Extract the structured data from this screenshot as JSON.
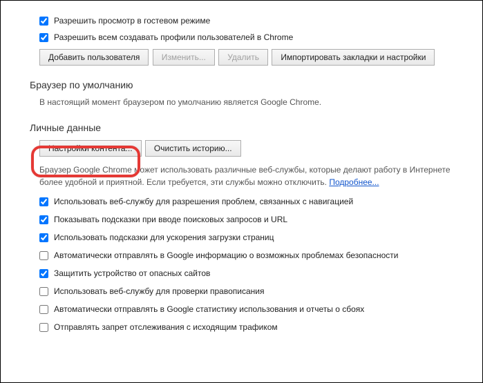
{
  "users_section": {
    "allow_guest": {
      "label": "Разрешить просмотр в гостевом режиме",
      "checked": true
    },
    "allow_create_profiles": {
      "label": "Разрешить всем создавать профили пользователей в Chrome",
      "checked": true
    },
    "btn_add": "Добавить пользователя",
    "btn_edit": "Изменить...",
    "btn_delete": "Удалить",
    "btn_import": "Импортировать закладки и настройки"
  },
  "default_browser": {
    "title": "Браузер по умолчанию",
    "text": "В настоящий момент браузером по умолчанию является Google Chrome."
  },
  "privacy": {
    "title": "Личные данные",
    "btn_content": "Настройки контента...",
    "btn_clear": "Очистить историю...",
    "desc": "Браузер Google Chrome может использовать различные веб-службы, которые делают работу в Интернете более удобной и приятной. Если требуется, эти службы можно отключить. ",
    "learn_more": "Подробнее...",
    "opts": [
      {
        "label": "Использовать веб-службу для разрешения проблем, связанных с навигацией",
        "checked": true
      },
      {
        "label": "Показывать подсказки при вводе поисковых запросов и URL",
        "checked": true
      },
      {
        "label": "Использовать подсказки для ускорения загрузки страниц",
        "checked": true
      },
      {
        "label": "Автоматически отправлять в Google информацию о возможных проблемах безопасности",
        "checked": false
      },
      {
        "label": "Защитить устройство от опасных сайтов",
        "checked": true
      },
      {
        "label": "Использовать веб-службу для проверки правописания",
        "checked": false
      },
      {
        "label": "Автоматически отправлять в Google статистику использования и отчеты о сбоях",
        "checked": false
      },
      {
        "label": "Отправлять запрет отслеживания с исходящим трафиком",
        "checked": false
      }
    ]
  }
}
